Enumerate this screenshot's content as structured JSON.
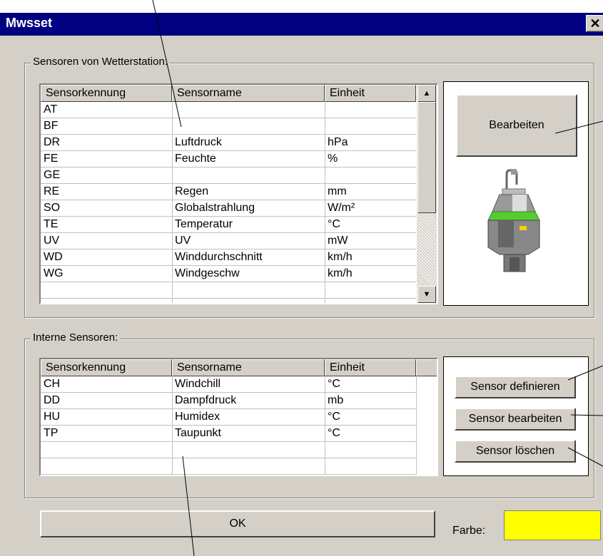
{
  "window": {
    "title": "Mwsset",
    "close_glyph": "✕"
  },
  "weather_group": {
    "label": "Sensoren von Wetterstation:",
    "columns": [
      "Sensorkennung",
      "Sensorname",
      "Einheit"
    ],
    "rows": [
      [
        "AT",
        "",
        ""
      ],
      [
        "BF",
        "",
        ""
      ],
      [
        "DR",
        "Luftdruck",
        "hPa"
      ],
      [
        "FE",
        "Feuchte",
        "%"
      ],
      [
        "GE",
        "",
        ""
      ],
      [
        "RE",
        "Regen",
        "mm"
      ],
      [
        "SO",
        "Globalstrahlung",
        "W/m²"
      ],
      [
        "TE",
        "Temperatur",
        "°C"
      ],
      [
        "UV",
        "UV",
        "mW"
      ],
      [
        "WD",
        "Winddurchschnitt",
        "km/h"
      ],
      [
        "WG",
        "Windgeschw",
        "km/h"
      ]
    ],
    "scroll_up": "▲",
    "scroll_down": "▼",
    "edit_button": "Bearbeiten"
  },
  "internal_group": {
    "label": "Interne Sensoren:",
    "columns": [
      "Sensorkennung",
      "Sensorname",
      "Einheit"
    ],
    "rows": [
      [
        "CH",
        "Windchill",
        "°C"
      ],
      [
        "DD",
        "Dampfdruck",
        "mb"
      ],
      [
        "HU",
        "Humidex",
        "°C"
      ],
      [
        "TP",
        "Taupunkt",
        "°C"
      ]
    ],
    "define_button": "Sensor definieren",
    "edit_button": "Sensor bearbeiten",
    "delete_button": "Sensor löschen"
  },
  "footer": {
    "ok_button": "OK",
    "color_label": "Farbe:",
    "color_value": "#ffff00"
  },
  "icons": {
    "sensor": "weather-sensor-icon"
  }
}
